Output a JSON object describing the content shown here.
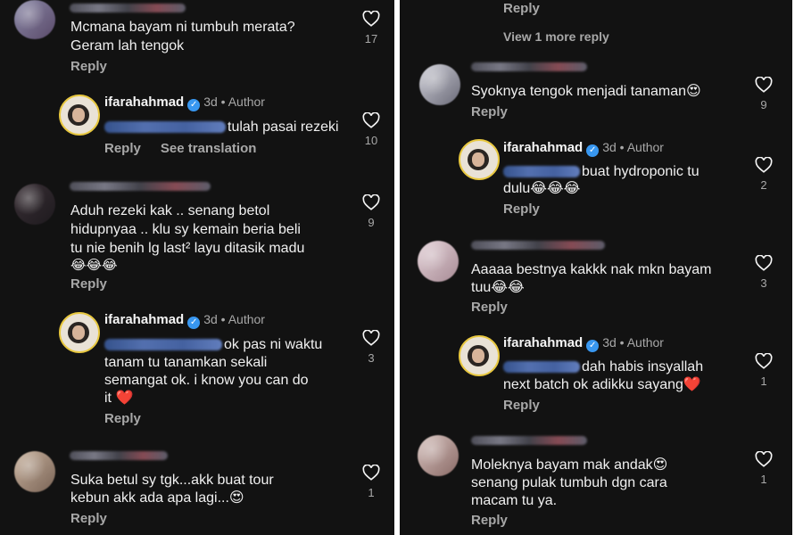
{
  "author": {
    "username": "ifarahahmad",
    "age": "3d",
    "author_label": "Author",
    "verified_mark": "✓"
  },
  "actions": {
    "reply": "Reply",
    "see_translation": "See translation",
    "view_more": "View 1 more reply"
  },
  "icons": {
    "like": "heart-outline-icon",
    "verified": "verified-badge-icon"
  },
  "left": {
    "c1": {
      "line1": "Mcmana bayam ni tumbuh merata?",
      "line2": "Geram lah tengok",
      "likes": "17"
    },
    "r1": {
      "text": "tulah pasai rezeki",
      "likes": "10"
    },
    "c2": {
      "line1": "Aduh rezeki kak .. senang betol",
      "line2": "hidupnyaa .. klu sy kemain beria beli",
      "line3": "tu nie benih lg last² layu ditasik madu",
      "line4": "😂😂😂",
      "likes": "9"
    },
    "r2": {
      "line1": "ok pas ni waktu",
      "line2": "tanam tu tanamkan sekali",
      "line3": "semangat ok. i know you  can do",
      "line4": "it ❤️",
      "likes": "3"
    },
    "c3": {
      "line1": "Suka betul sy tgk...akk buat tour",
      "line2": "kebun akk ada apa lagi...😍",
      "likes": "1"
    }
  },
  "right": {
    "c1": {
      "line1": "Syoknya tengok menjadi tanaman😍",
      "likes": "9"
    },
    "r1": {
      "line1": "buat hydroponic tu",
      "line2": "dulu😂😂😂",
      "likes": "2"
    },
    "c2": {
      "line1": "Aaaaa bestnya kakkk nak mkn bayam",
      "line2": "tuu😂😂",
      "likes": "3"
    },
    "r2": {
      "line1": "dah habis insyallah",
      "line2": "next batch ok adikku sayang❤️",
      "likes": "1"
    },
    "c3": {
      "line1": "Moleknya bayam mak andak😍",
      "line2": "senang pulak tumbuh dgn cara",
      "line3": "macam tu ya.",
      "likes": "1"
    }
  }
}
